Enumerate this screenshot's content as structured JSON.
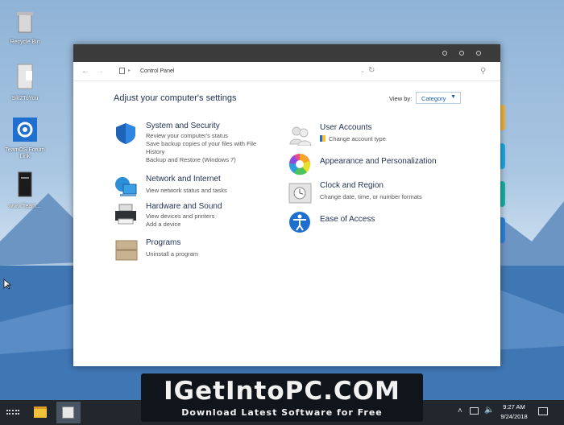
{
  "desktop": {
    "icons": [
      {
        "label": "Recycle Bin"
      },
      {
        "label": "Sitl2ToYou"
      },
      {
        "label": "TeamOS Forum Link"
      },
      {
        "label": "www.Team..."
      }
    ]
  },
  "window": {
    "address": "Control Panel",
    "heading": "Adjust your computer's settings",
    "view_by_label": "View by:",
    "view_by_value": "Category",
    "items_left": [
      {
        "title": "System and Security",
        "links": [
          "Review your computer's status",
          "Save backup copies of your files with File",
          "History",
          "Backup and Restore (Windows 7)"
        ]
      },
      {
        "title": "Network and Internet",
        "links": [
          "View network status and tasks"
        ]
      },
      {
        "title": "Hardware and Sound",
        "links": [
          "View devices and printers",
          "Add a device"
        ]
      },
      {
        "title": "Programs",
        "links": [
          "Uninstall a program"
        ]
      }
    ],
    "items_right": [
      {
        "title": "User Accounts",
        "links": [
          "Change account type"
        ]
      },
      {
        "title": "Appearance and Personalization",
        "links": []
      },
      {
        "title": "Clock and Region",
        "links": [
          "Change date, time, or number formats"
        ]
      },
      {
        "title": "Ease of Access",
        "links": []
      }
    ]
  },
  "banner": {
    "title": "IGetIntoPC.COM",
    "subtitle": "Download Latest Software for Free"
  },
  "taskbar": {
    "time": "9:27 AM",
    "date": "9/24/2018"
  }
}
